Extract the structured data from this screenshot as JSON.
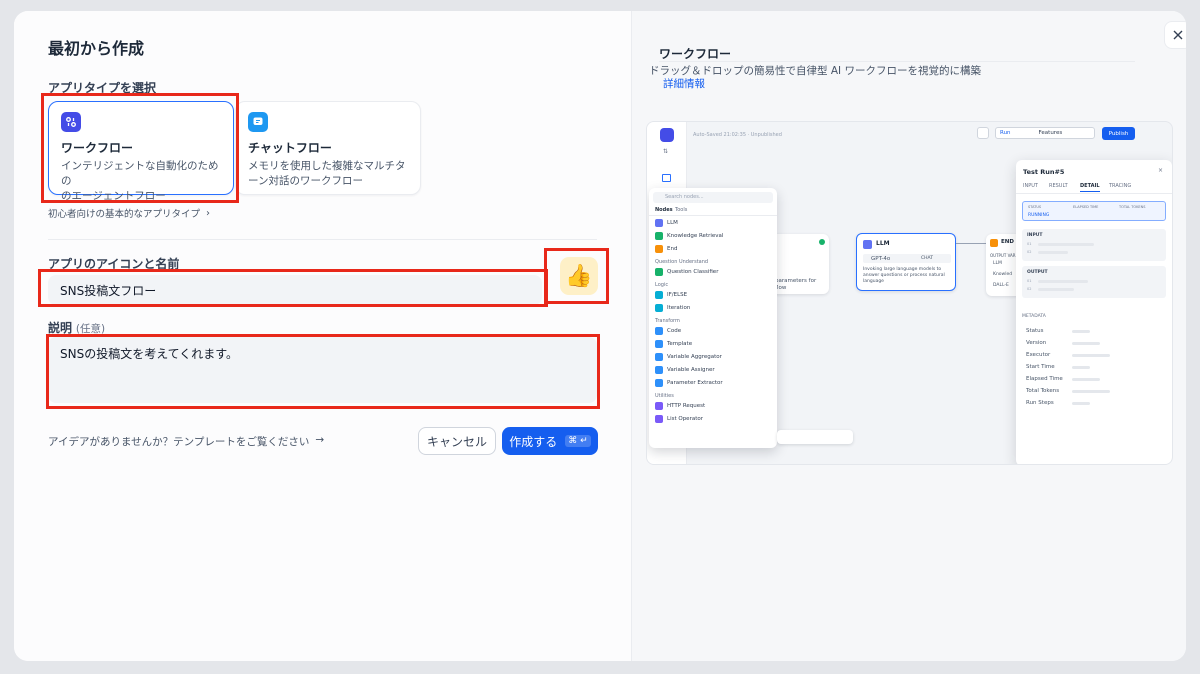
{
  "modal": {
    "title": "最初から作成",
    "close_icon": "close-icon",
    "app_type_label": "アプリタイプを選択",
    "app_types": [
      {
        "title": "ワークフロー",
        "desc1": "インテリジェントな自動化のための",
        "desc2": "のエージェントフロー",
        "icon": "workflow-icon",
        "color": "#444ce7"
      },
      {
        "title": "チャットフロー",
        "desc1": "メモリを使用した複雑なマルチタ",
        "desc2": "ーン対話のワークフロー",
        "icon": "chatflow-icon",
        "color": "#1e98f1"
      }
    ],
    "beginner_link": "初心者向けの基本的なアプリタイプ",
    "icon_name_label": "アプリのアイコンと名前",
    "app_name_value": "SNS投稿文フロー",
    "app_icon": "👍",
    "description_label": "説明",
    "description_optional": "(任意)",
    "description_value": "SNSの投稿文を考えてくれます。",
    "idea_link": "アイデアがありませんか？テンプレートをご覧ください",
    "cancel_label": "キャンセル",
    "create_label": "作成する",
    "create_shortcut": "⌘ ↵",
    "accent_color": "#155eef",
    "highlight_color": "#e8281a"
  },
  "preview": {
    "title": "ワークフロー",
    "subtitle": "ドラッグ＆ドロップの簡易性で自律型 AI ワークフローを視覚的に構築",
    "more_link": "詳細情報",
    "toolbar": {
      "autosaved": "Auto-Saved 21:02:35 · Unpublished",
      "run": "Run",
      "features": "Features",
      "publish": "Publish"
    },
    "search_placeholder": "Search nodes...",
    "tabs": [
      "Nodes",
      "Tools"
    ],
    "node_list": [
      {
        "group": "",
        "items": [
          "LLM",
          "Knowledge Retrieval",
          "End"
        ]
      },
      {
        "group": "Question Understand",
        "items": [
          "Question Classifier"
        ]
      },
      {
        "group": "Logic",
        "items": [
          "IF/ELSE",
          "Iteration"
        ]
      },
      {
        "group": "Transform",
        "items": [
          "Code",
          "Template",
          "Variable Aggregator",
          "Variable Assigner",
          "Parameter Extractor"
        ]
      },
      {
        "group": "Utilities",
        "items": [
          "HTTP Request",
          "List Operator"
        ]
      }
    ],
    "llm_node": {
      "title": "LLM",
      "model": "GPT-4o",
      "mode": "CHAT",
      "desc": "Invoking large language models to answer questions or process natural language"
    },
    "end_node": {
      "title": "END",
      "output_label": "OUTPUT VARI",
      "rows": [
        "LLM",
        "Knowled",
        "DALL-E"
      ]
    },
    "prev_node_desc": "parameters for",
    "prev_node_desc2": "flow",
    "test_run": {
      "title": "Test Run#5",
      "tabs": [
        "INPUT",
        "RESULT",
        "DETAIL",
        "TRACING"
      ],
      "active_tab": "DETAIL",
      "status_label": "STATUS",
      "status_value": "RUNNING",
      "elapsed_label": "ELAPSED TIME",
      "tokens_label": "TOTAL TOKENS",
      "input_label": "INPUT",
      "output_label": "OUTPUT",
      "row_labels": [
        "01",
        "02"
      ],
      "metadata_label": "METADATA",
      "metadata_rows": [
        "Status",
        "Version",
        "Executor",
        "Start Time",
        "Elapsed Time",
        "Total Tokens",
        "Run Steps"
      ]
    }
  }
}
